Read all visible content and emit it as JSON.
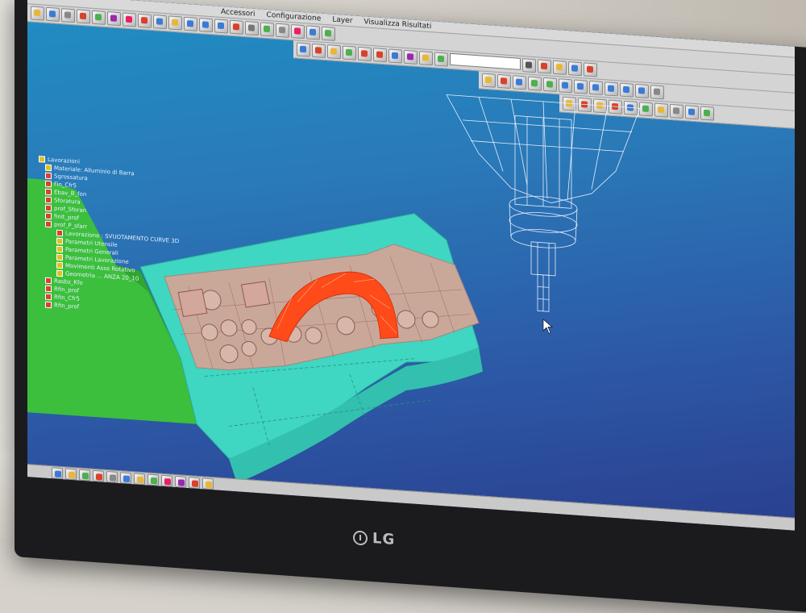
{
  "app": {
    "menu": [
      "Accessori",
      "Configurazione",
      "Layer",
      "Visualizza Risultati"
    ],
    "dropdown_value": ""
  },
  "tree": {
    "root": "Lavorazioni",
    "items": [
      {
        "label": "Materiale: Alluminio di Barra",
        "level": 1,
        "color": "y"
      },
      {
        "label": "Sgrossatura",
        "level": 1,
        "color": "r"
      },
      {
        "label": "Fin_Cfr5",
        "level": 1,
        "color": "r"
      },
      {
        "label": "Ebav_B_fon",
        "level": 1,
        "color": "r"
      },
      {
        "label": "Sforatura",
        "level": 1,
        "color": "r"
      },
      {
        "label": "prof_Sforan",
        "level": 1,
        "color": "r"
      },
      {
        "label": "finit_prof",
        "level": 1,
        "color": "r"
      },
      {
        "label": "prof_P_sfarr",
        "level": 1,
        "color": "r"
      },
      {
        "label": "Lavorazione : SVUOTAMENTO CURVE 3D",
        "level": 2,
        "color": "r"
      },
      {
        "label": "Parametri Utensile",
        "level": 2,
        "color": "y"
      },
      {
        "label": "Parametri Generali",
        "level": 2,
        "color": "y"
      },
      {
        "label": "Parametri Lavorazione",
        "level": 2,
        "color": "y"
      },
      {
        "label": "Movimenti Asse Rotativo",
        "level": 2,
        "color": "y"
      },
      {
        "label": "Geometria ... ANZA 20_10",
        "level": 2,
        "color": "y"
      },
      {
        "label": "Rasbz_Kfo",
        "level": 1,
        "color": "r"
      },
      {
        "label": "Rfin_prof",
        "level": 1,
        "color": "r"
      },
      {
        "label": "Rfin_Cfr5",
        "level": 1,
        "color": "r"
      },
      {
        "label": "Rfin_prof",
        "level": 1,
        "color": "r"
      }
    ]
  },
  "bezel": {
    "brand": "LG"
  },
  "colors": {
    "background_top": "#1f8fc3",
    "background_bottom": "#2a3f8e",
    "part_cyan": "#3fd6c2",
    "fixture_green": "#3cbf3c",
    "toolpath_red": "#ff4a1a",
    "pocket_floor": "#c9a89a"
  },
  "icons": {
    "toolbar": [
      "file-icon",
      "save-icon",
      "print-icon",
      "undo-icon",
      "zoom-icon",
      "rotate-icon",
      "layer-icon",
      "tool-icon",
      "simulate-icon",
      "settings-icon"
    ],
    "scene": [
      "wireframe-spindle-icon",
      "mouse-cursor-icon"
    ]
  }
}
